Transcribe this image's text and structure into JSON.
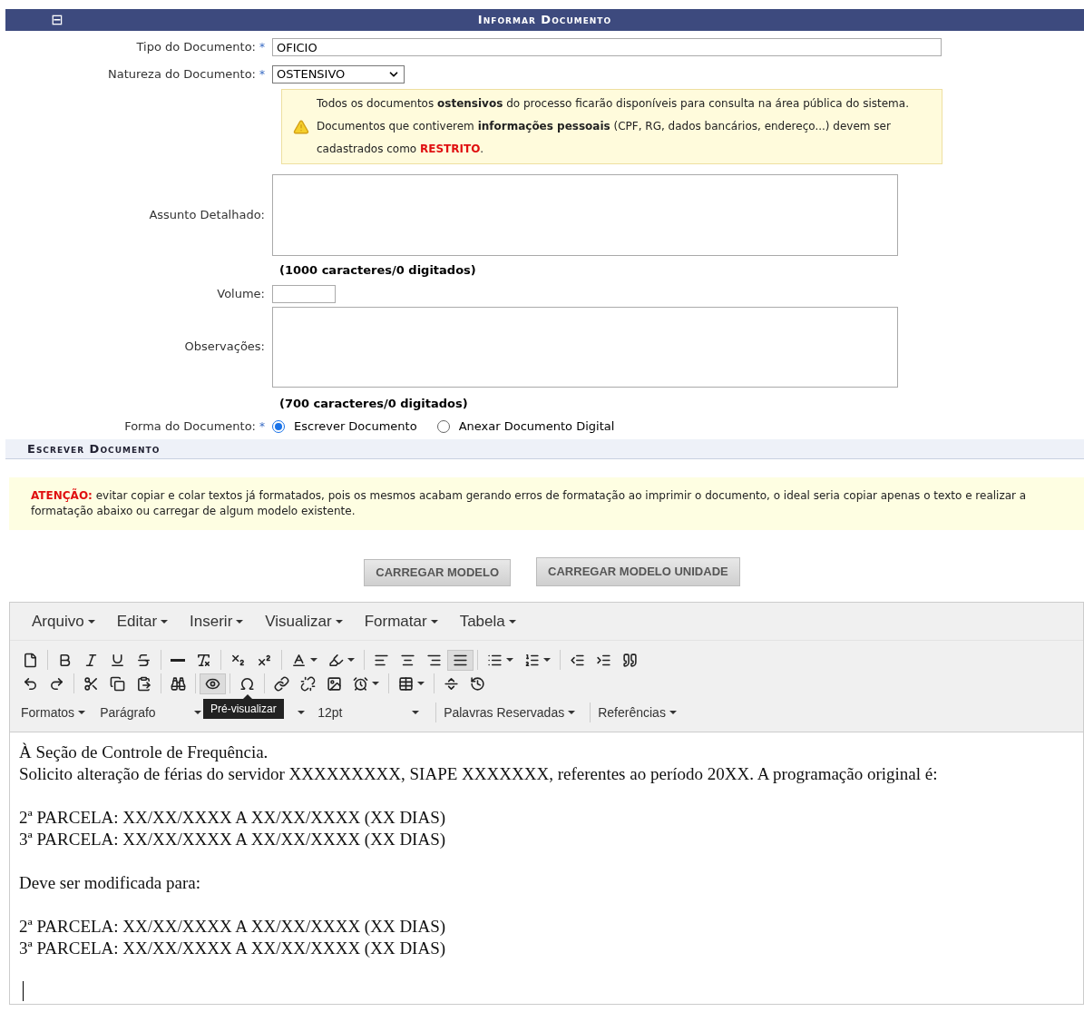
{
  "header": {
    "title": "Informar Documento",
    "collapse_icon": "⊟"
  },
  "form": {
    "tipo": {
      "label": "Tipo do Documento:",
      "value": "OFICIO",
      "required_mark": "*"
    },
    "natureza": {
      "label": "Natureza do Documento:",
      "value": "OSTENSIVO",
      "required_mark": "*"
    },
    "notice": {
      "lines": [
        "Todos os documentos **ostensivos** do processo ficarão disponíveis para consulta na área pública do sistema.",
        "Documentos que contiverem **informações pessoais** (CPF, RG, dados bancários, endereço...) devem ser"
      ],
      "last_line": "cadastrados como ",
      "highlight": "RESTRITO",
      "end": "."
    },
    "assunto": {
      "label": "Assunto Detalhado:",
      "counter": "(1000 caracteres/0 digitados)"
    },
    "volume": {
      "label": "Volume:"
    },
    "observacoes": {
      "label": "Observações:",
      "counter": "(700 caracteres/0 digitados)"
    },
    "forma": {
      "label": "Forma do Documento:",
      "required_mark": "*",
      "options": [
        {
          "label": "Escrever Documento",
          "selected": true
        },
        {
          "label": "Anexar Documento Digital",
          "selected": false
        }
      ]
    }
  },
  "section": {
    "title": "Escrever Documento"
  },
  "warning": {
    "label": "ATENÇÃO:",
    "text": " evitar copiar e colar textos já formatados, pois os mesmos acabam gerando erros de formatação ao imprimir o documento, o ideal seria copiar apenas o texto e realizar a formatação abaixo ou carregar de algum modelo existente."
  },
  "buttons": [
    "CARREGAR MODELO",
    "CARREGAR MODELO UNIDADE"
  ],
  "editor": {
    "menus": [
      "Arquivo",
      "Editar",
      "Inserir",
      "Visualizar",
      "Formatar",
      "Tabela"
    ],
    "justify_selected": true,
    "preview_selected": true,
    "format_row": [
      {
        "label": "Formatos",
        "kind": "menu"
      },
      {
        "label": "Parágrafo",
        "kind": "select"
      },
      {
        "kind": "hidden"
      },
      {
        "label": "12pt",
        "kind": "select"
      },
      {
        "label": "Palavras Reservadas",
        "kind": "menu"
      },
      {
        "label": "Referências",
        "kind": "menu"
      }
    ],
    "tooltip": "Pré-visualizar",
    "content": [
      [
        "À Seção de Controle de Frequência.",
        "Solicito alteração de férias do servidor XXXXXXXXX, SIAPE XXXXXXX, referentes ao período 20XX. A programação original é:"
      ],
      [
        "2ª PARCELA: XX/XX/XXXX A XX/XX/XXXX (XX DIAS)",
        "3ª PARCELA: XX/XX/XXXX A XX/XX/XXXX (XX DIAS)"
      ],
      [
        "Deve ser modificada para:"
      ],
      [
        "2ª PARCELA: XX/XX/XXXX A XX/XX/XXXX (XX DIAS)",
        "3ª PARCELA: XX/XX/XXXX A XX/XX/XXXX (XX DIAS)"
      ]
    ]
  }
}
